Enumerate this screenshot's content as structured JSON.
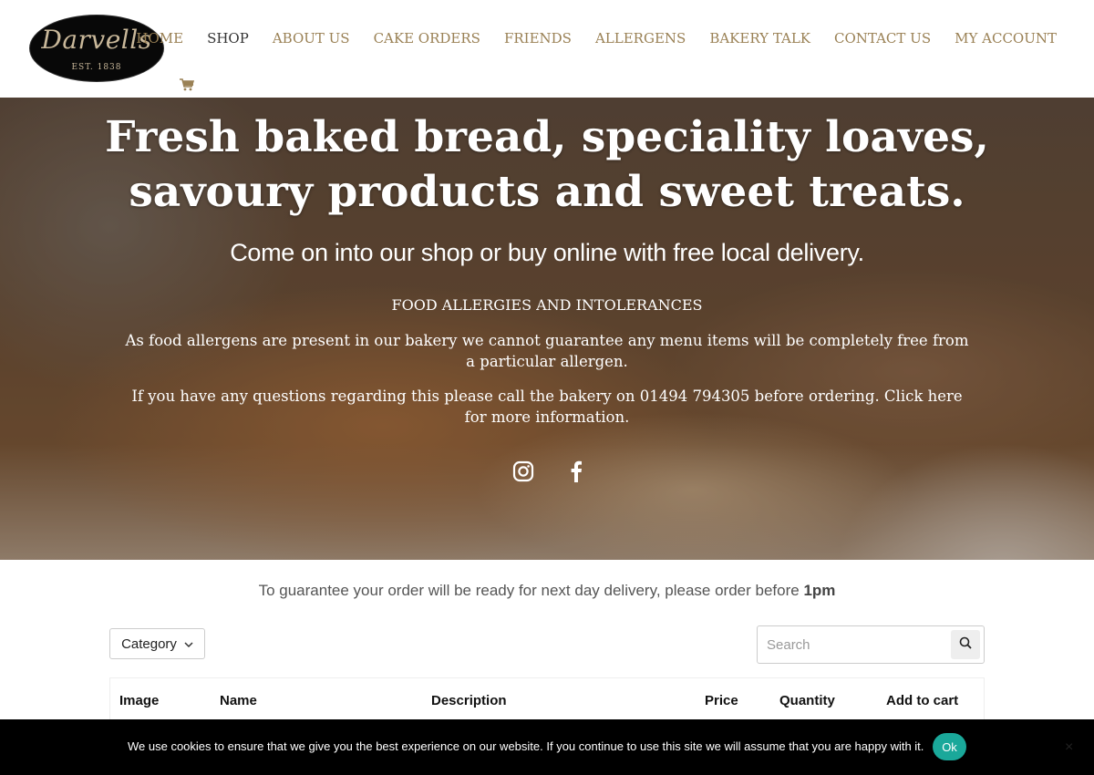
{
  "header": {
    "logo_text": "Darvells",
    "logo_est": "EST. 1838",
    "nav": [
      {
        "label": "HOME",
        "active": false
      },
      {
        "label": "SHOP",
        "active": true
      },
      {
        "label": "ABOUT US",
        "active": false
      },
      {
        "label": "CAKE ORDERS",
        "active": false
      },
      {
        "label": "FRIENDS",
        "active": false
      },
      {
        "label": "ALLERGENS",
        "active": false
      },
      {
        "label": "BAKERY TALK",
        "active": false
      },
      {
        "label": "CONTACT US",
        "active": false
      },
      {
        "label": "MY ACCOUNT",
        "active": false
      }
    ],
    "cart_icon": "shopping-cart-icon"
  },
  "hero": {
    "title": "Fresh baked bread, speciality loaves, savoury products and sweet treats.",
    "subtitle": "Come on into our shop or buy online with free local delivery.",
    "allergy_heading": "FOOD ALLERGIES AND INTOLERANCES",
    "allergy_text": "As food allergens are present in our bakery we cannot guarantee any menu items will be completely free from a particular allergen.",
    "contact_text": "If you have any questions regarding this please call the bakery on 01494 794305 before ordering. Click here for more information.",
    "social": [
      "instagram-icon",
      "facebook-icon"
    ]
  },
  "shop": {
    "notice_prefix": "To guarantee your order will be ready for next day delivery, please order before ",
    "notice_time": "1pm",
    "category_label": "Category",
    "search_placeholder": "Search",
    "columns": [
      "Image",
      "Name",
      "Description",
      "Price",
      "Quantity",
      "Add to cart"
    ]
  },
  "cookie": {
    "message": "We use cookies to ensure that we give you the best experience on our website. If you continue to use this site we will assume that you are happy with it.",
    "ok_label": "Ok",
    "close_label": "×"
  },
  "colors": {
    "nav_text": "#9a8155",
    "nav_active": "#333333",
    "cookie_ok": "#1aa89a"
  }
}
